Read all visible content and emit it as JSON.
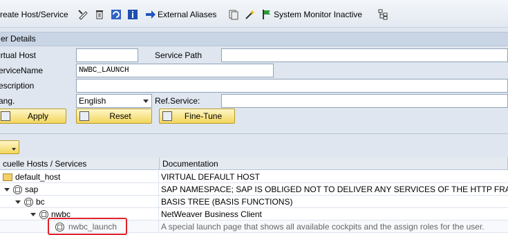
{
  "toolbar": {
    "create_label": "reate Host/Service",
    "external_aliases_label": "External Aliases",
    "system_monitor_label": "System Monitor Inactive"
  },
  "filter_section": {
    "header": "er Details",
    "virtual_host_label": "irtual Host",
    "virtual_host_value": "",
    "service_path_label": "Service Path",
    "service_path_value": "",
    "service_name_label": "erviceName",
    "service_name_value": "NWBC_LAUNCH",
    "description_label": "escription",
    "description_value": "",
    "lang_label": "ang.",
    "lang_value": "English",
    "ref_service_label": "Ref.Service:",
    "ref_service_value": "",
    "apply_label": "Apply",
    "reset_label": "Reset",
    "finetune_label": "Fine-Tune"
  },
  "tree": {
    "col_host": "cuelle Hosts / Services",
    "col_doc": "Documentation",
    "rows": [
      {
        "name": "default_host",
        "doc": "VIRTUAL DEFAULT HOST"
      },
      {
        "name": "sap",
        "doc": "SAP NAMESPACE; SAP IS OBLIGED NOT TO DELIVER ANY SERVICES OF THE HTTP FRA..."
      },
      {
        "name": "bc",
        "doc": "BASIS TREE (BASIS FUNCTIONS)"
      },
      {
        "name": "nwbc",
        "doc": "NetWeaver Business Client"
      },
      {
        "name": "nwbc_launch",
        "doc": "A special launch page that shows all available cockpits and the assign roles for the user."
      }
    ]
  },
  "colors": {
    "highlight": "#e0202a",
    "button": "#f2d65c",
    "header": "#c9d5e4"
  }
}
